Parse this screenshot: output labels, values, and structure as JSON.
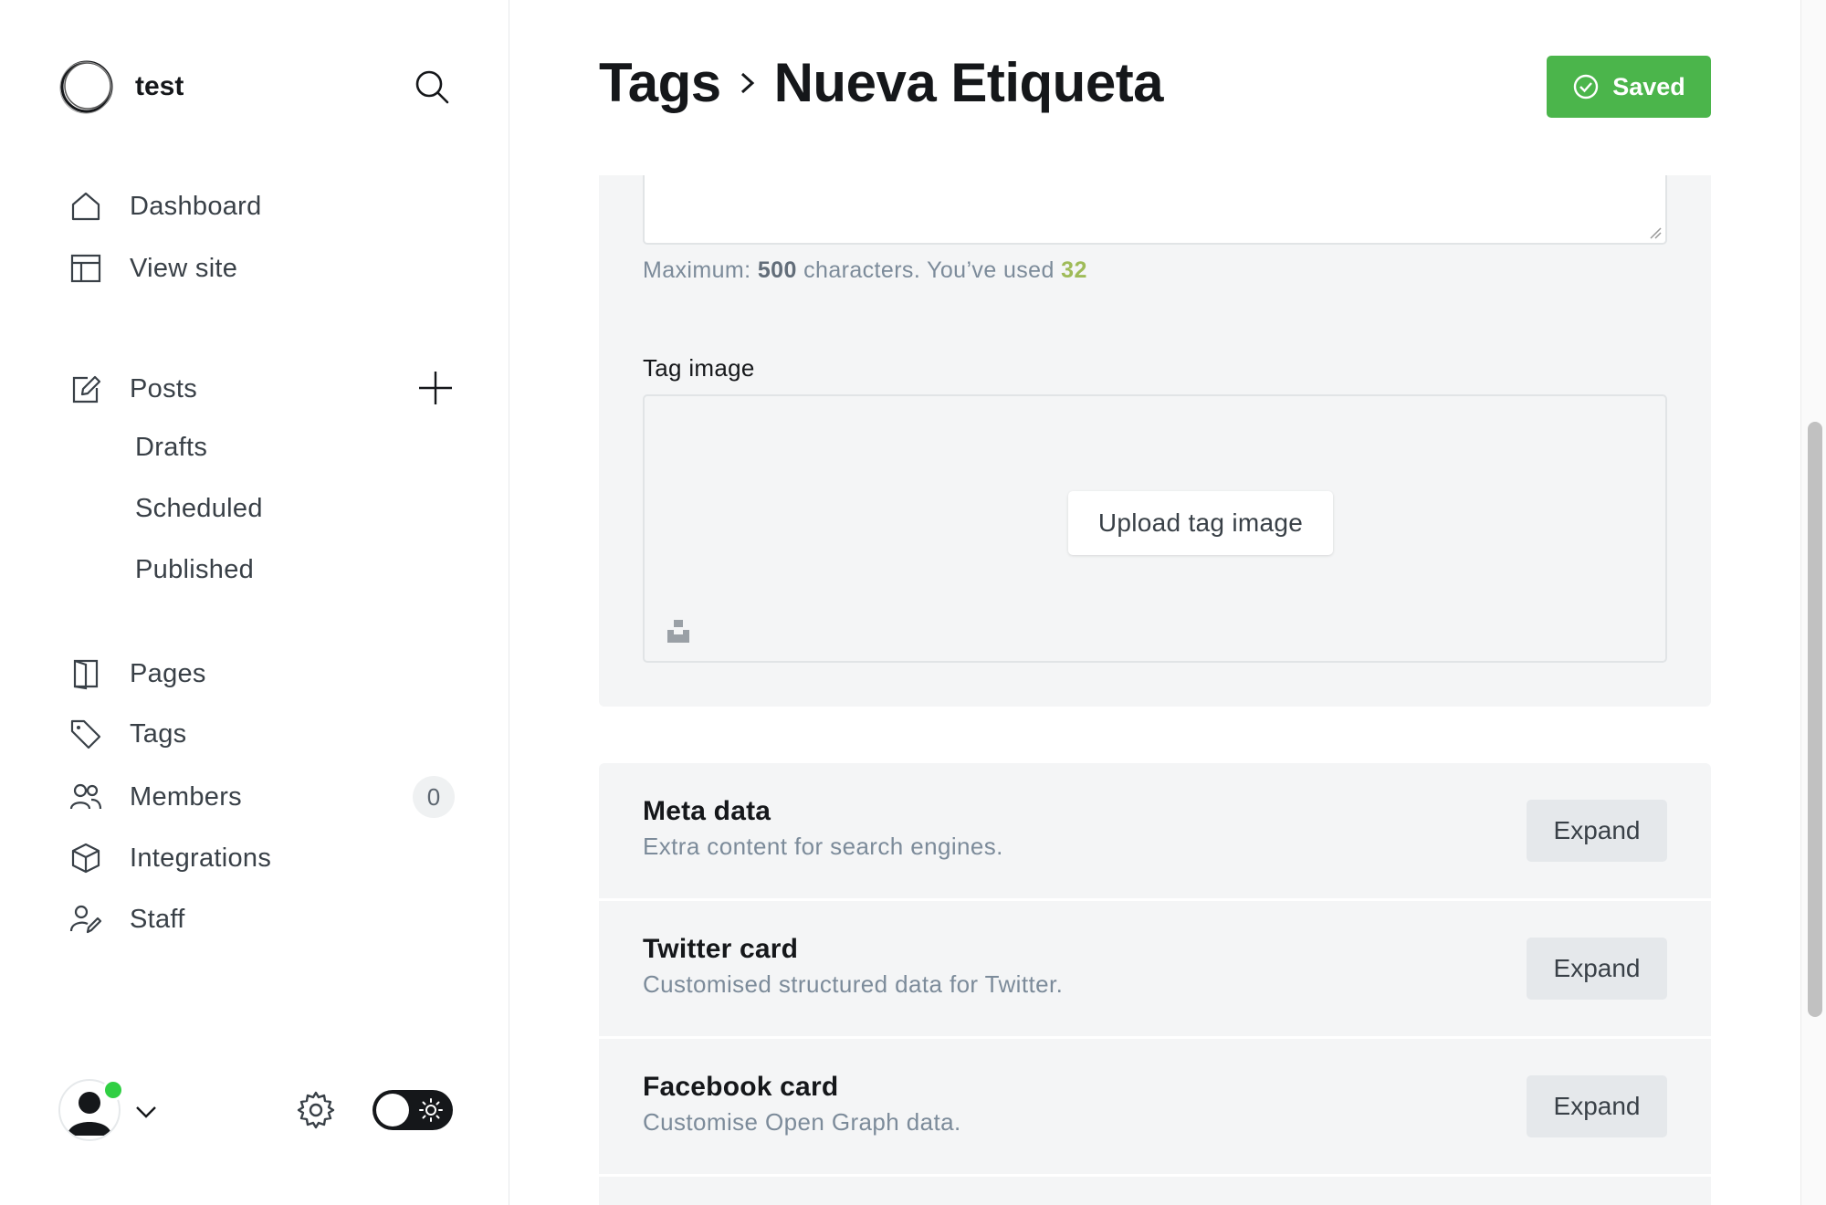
{
  "sidebar": {
    "site_name": "test",
    "nav": {
      "dashboard": "Dashboard",
      "view_site": "View site",
      "posts": "Posts",
      "drafts": "Drafts",
      "scheduled": "Scheduled",
      "published": "Published",
      "pages": "Pages",
      "tags": "Tags",
      "members": "Members",
      "members_count": "0",
      "integrations": "Integrations",
      "staff": "Staff"
    }
  },
  "header": {
    "breadcrumb_parent": "Tags",
    "breadcrumb_current": "Nueva Etiqueta",
    "saved_label": "Saved",
    "saved_color": "#4bb54b"
  },
  "form": {
    "hint_prefix": "Maximum:",
    "hint_max": "500",
    "hint_middle": "characters. You’ve used",
    "hint_used": "32",
    "tag_image_label": "Tag image",
    "upload_label": "Upload tag image"
  },
  "sections": {
    "meta": {
      "title": "Meta data",
      "desc": "Extra content for search engines.",
      "button": "Expand"
    },
    "twitter": {
      "title": "Twitter card",
      "desc": "Customised structured data for Twitter.",
      "button": "Expand"
    },
    "facebook": {
      "title": "Facebook card",
      "desc": "Customise Open Graph data.",
      "button": "Expand"
    }
  },
  "icons": {
    "brand": "ghost-logo-icon",
    "search": "search-icon",
    "dashboard": "home-icon",
    "view_site": "layout-icon",
    "posts": "edit-icon",
    "add_post": "plus-icon",
    "pages": "page-icon",
    "tags": "tag-icon",
    "members": "users-icon",
    "integrations": "box-icon",
    "staff": "staff-icon",
    "settings": "gear-icon",
    "theme": "sun-icon"
  }
}
